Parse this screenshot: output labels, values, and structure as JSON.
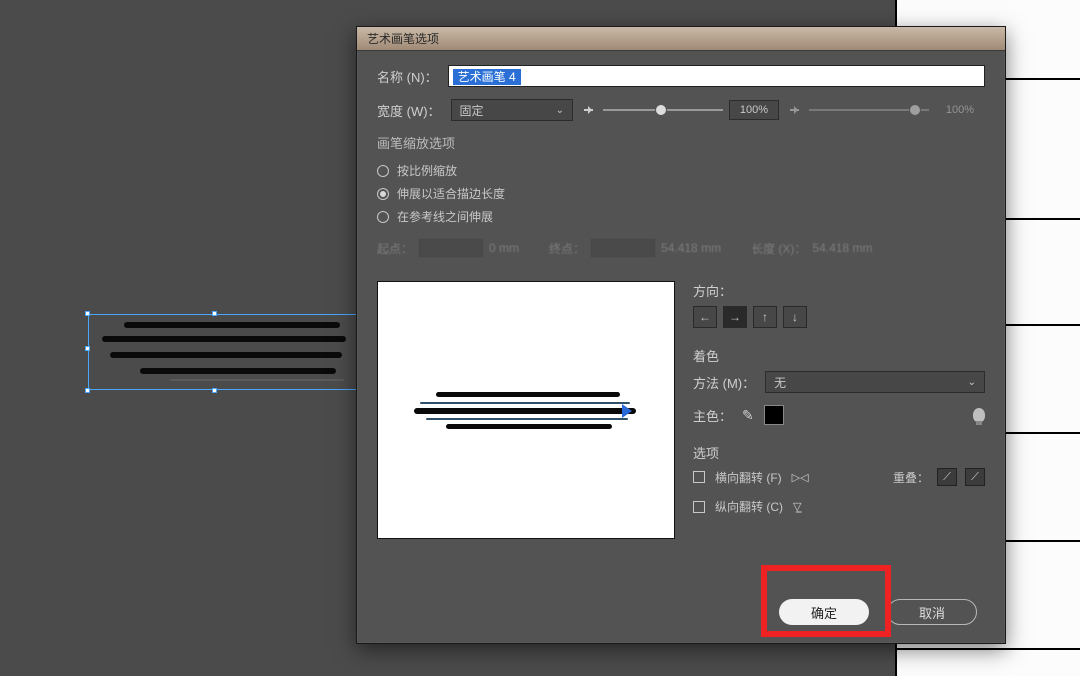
{
  "dialog": {
    "title": "艺术画笔选项",
    "name_label": "名称 (N)：",
    "name_value": "艺术画笔 4",
    "width_label": "宽度 (W)：",
    "width_mode": "固定",
    "width_percent": "100%",
    "width_percent2": "100%",
    "scale": {
      "title": "画笔缩放选项",
      "opt1": "按比例缩放",
      "opt2": "伸展以适合描边长度",
      "opt3": "在参考线之间伸展"
    },
    "guides": {
      "start_label": "起点：",
      "start_val": "0 mm",
      "end_label": "终点：",
      "end_val": "54.418 mm",
      "len_label": "长度 (X)：",
      "len_val": "54.418 mm"
    },
    "direction": {
      "title": "方向："
    },
    "color": {
      "title": "着色",
      "method_label": "方法 (M)：",
      "method_value": "无",
      "key_label": "主色："
    },
    "options": {
      "title": "选项",
      "flip_h": "横向翻转 (F)",
      "flip_v": "纵向翻转 (C)",
      "overlap_label": "重叠："
    },
    "ok": "确定",
    "cancel": "取消"
  }
}
